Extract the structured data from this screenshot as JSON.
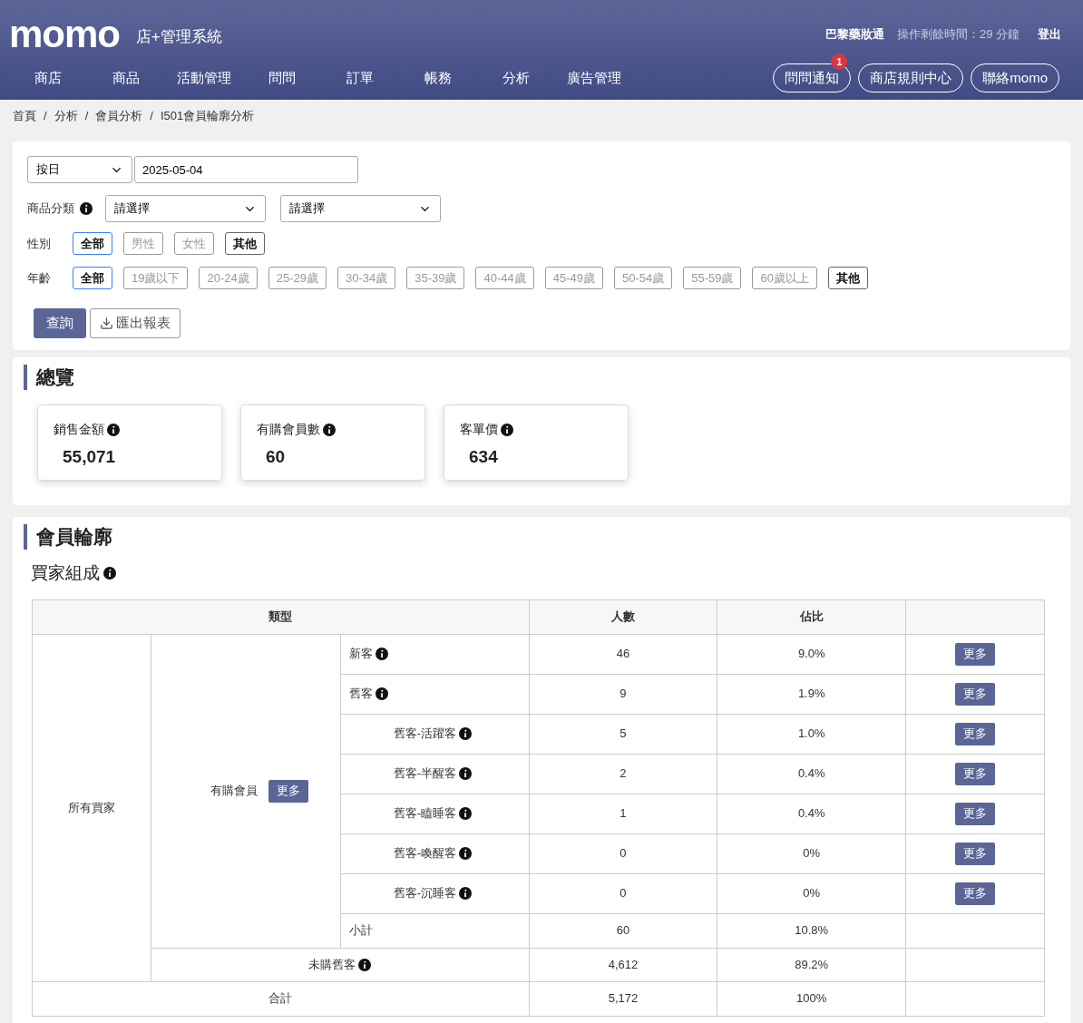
{
  "header": {
    "logo": "momo",
    "system_name": "店+管理系統",
    "shop_name": "巴黎藥妝通",
    "session_text": "操作剩餘時間：29 分鐘",
    "logout": "登出",
    "nav": [
      "商店",
      "商品",
      "活動管理",
      "問問",
      "訂單",
      "帳務",
      "分析",
      "廣告管理"
    ],
    "actions": [
      {
        "label": "問問通知",
        "badge": "1"
      },
      {
        "label": "商店規則中心"
      },
      {
        "label": "聯絡momo"
      }
    ]
  },
  "breadcrumb": [
    "首頁",
    "分析",
    "會員分析",
    "I501會員輪廓分析"
  ],
  "separator": "/",
  "filters": {
    "period": "按日",
    "date": "2025-05-04",
    "category_label": "商品分類",
    "category_selects": [
      "請選擇",
      "請選擇"
    ],
    "gender_label": "性別",
    "gender": [
      {
        "label": "全部",
        "selected": true,
        "disabled": false
      },
      {
        "label": "男性",
        "selected": false,
        "disabled": true
      },
      {
        "label": "女性",
        "selected": false,
        "disabled": true
      },
      {
        "label": "其他",
        "selected": false,
        "disabled": false
      }
    ],
    "age_label": "年齡",
    "age": [
      {
        "label": "全部",
        "selected": true,
        "disabled": false
      },
      {
        "label": "19歲以下",
        "selected": false,
        "disabled": true
      },
      {
        "label": "20-24歲",
        "selected": false,
        "disabled": true
      },
      {
        "label": "25-29歲",
        "selected": false,
        "disabled": true
      },
      {
        "label": "30-34歲",
        "selected": false,
        "disabled": true
      },
      {
        "label": "35-39歲",
        "selected": false,
        "disabled": true
      },
      {
        "label": "40-44歲",
        "selected": false,
        "disabled": true
      },
      {
        "label": "45-49歲",
        "selected": false,
        "disabled": true
      },
      {
        "label": "50-54歲",
        "selected": false,
        "disabled": true
      },
      {
        "label": "55-59歲",
        "selected": false,
        "disabled": true
      },
      {
        "label": "60歲以上",
        "selected": false,
        "disabled": true
      },
      {
        "label": "其他",
        "selected": false,
        "disabled": false
      }
    ],
    "query_button": "查詢",
    "export_button": "匯出報表"
  },
  "overview": {
    "title": "總覽",
    "cards": [
      {
        "label": "銷售金額",
        "value": "55,071"
      },
      {
        "label": "有購會員數",
        "value": "60"
      },
      {
        "label": "客單價",
        "value": "634"
      }
    ]
  },
  "profile": {
    "title": "會員輪廓",
    "subtitle": "買家組成",
    "table": {
      "columns": [
        "類型",
        "人數",
        "佔比"
      ],
      "all_buyers": "所有買家",
      "purchased_members": "有購會員",
      "purchased_more": "更多",
      "rows": [
        {
          "kind": "main",
          "label": "新客",
          "count": "46",
          "share": "9.0%",
          "more": "更多"
        },
        {
          "kind": "main",
          "label": "舊客",
          "count": "9",
          "share": "1.9%",
          "more": "更多"
        },
        {
          "kind": "sub",
          "label": "舊客-活躍客",
          "count": "5",
          "share": "1.0%",
          "more": "更多"
        },
        {
          "kind": "sub",
          "label": "舊客-半醒客",
          "count": "2",
          "share": "0.4%",
          "more": "更多"
        },
        {
          "kind": "sub",
          "label": "舊客-瞌睡客",
          "count": "1",
          "share": "0.4%",
          "more": "更多"
        },
        {
          "kind": "sub",
          "label": "舊客-喚醒客",
          "count": "0",
          "share": "0%",
          "more": "更多"
        },
        {
          "kind": "sub",
          "label": "舊客-沉睡客",
          "count": "0",
          "share": "0%",
          "more": "更多"
        }
      ],
      "subtotal": {
        "label": "小計",
        "count": "60",
        "share": "10.8%"
      },
      "non_purchased": {
        "label": "未購舊客",
        "count": "4,612",
        "share": "89.2%"
      },
      "total": {
        "label": "合計",
        "count": "5,172",
        "share": "100%"
      }
    }
  }
}
